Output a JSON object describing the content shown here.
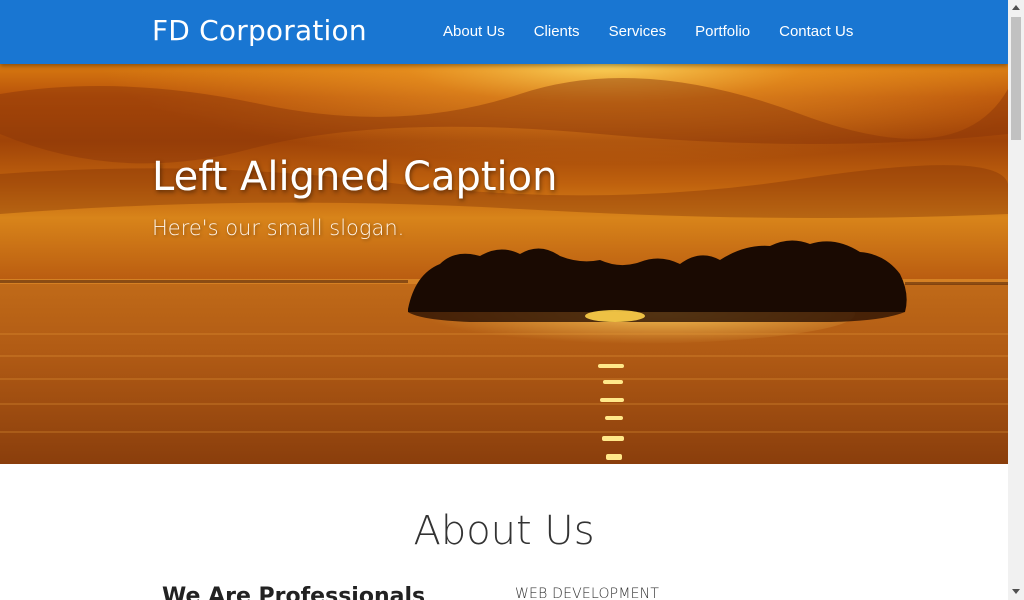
{
  "navbar": {
    "brand": "FD Corporation",
    "links": [
      "About Us",
      "Clients",
      "Services",
      "Portfolio",
      "Contact Us"
    ],
    "color": "#1976d2"
  },
  "hero": {
    "title": "Left Aligned Caption",
    "subtitle": "Here's our small slogan.",
    "image": "sunset-over-lake-with-island"
  },
  "about": {
    "title": "About Us",
    "subtitle": "We Are Professionals",
    "category": "WEB DEVELOPMENT"
  }
}
